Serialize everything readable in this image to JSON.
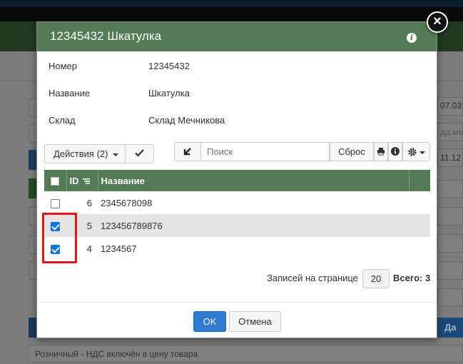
{
  "modal": {
    "title": "12345432 Шкатулка",
    "info_icon": "info-icon",
    "close_icon": "close-icon"
  },
  "properties": [
    {
      "label": "Номер",
      "value": "12345432"
    },
    {
      "label": "Название",
      "value": "Шкатулка"
    },
    {
      "label": "Склад",
      "value": "Склад Мечникова"
    }
  ],
  "toolbar": {
    "actions_label": "Действия (2)",
    "search_placeholder": "Поиск",
    "reset_label": "Сброс"
  },
  "table": {
    "columns": [
      "ID",
      "Название"
    ],
    "rows": [
      {
        "id": "6",
        "name": "2345678098",
        "checked": false
      },
      {
        "id": "5",
        "name": "123456789876",
        "checked": true
      },
      {
        "id": "4",
        "name": "1234567",
        "checked": true
      }
    ]
  },
  "paging": {
    "per_page_label": "Записей на странице",
    "page_size": "20",
    "total_label": "Всего: 3"
  },
  "footer": {
    "ok_label": "OK",
    "cancel_label": "Отмена"
  },
  "background": {
    "right_texts": [
      "07.03",
      "дд.мм",
      "11.12"
    ],
    "yes_label": "Да",
    "bottom_field": "Розничный - НДС включён в цену товара"
  },
  "colors": {
    "header_green": "#547c54",
    "primary_blue": "#2f7bd2",
    "highlight_red": "#e3171a",
    "checkbox_blue": "#0b74e5"
  }
}
